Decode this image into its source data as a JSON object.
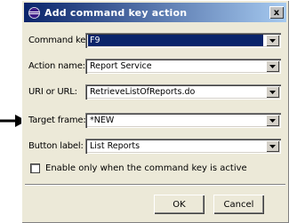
{
  "window": {
    "title": "Add command key action",
    "close_glyph": "x"
  },
  "fields": [
    {
      "label": "Command key:",
      "value": "F9",
      "selected": true
    },
    {
      "label": "Action name:",
      "value": "Report Service",
      "selected": false
    },
    {
      "label": "URI or URL:",
      "value": "RetrieveListOfReports.do",
      "selected": false
    },
    {
      "label": "Target frame:",
      "value": "*NEW",
      "selected": false
    },
    {
      "label": "Button label:",
      "value": "List Reports",
      "selected": false
    }
  ],
  "checkbox": {
    "label": "Enable only when the command key is active",
    "checked": false
  },
  "buttons": {
    "ok_label": "OK",
    "cancel_label": "Cancel"
  },
  "colors": {
    "title_gradient_start": "#0a246a",
    "title_gradient_end": "#a6caf0",
    "selection": "#0a246a",
    "dialog_bg": "#ece9d8"
  },
  "icons": {
    "app": "eclipse-icon",
    "dropdown": "chevron-down-icon",
    "pointer": "arrow-right-icon"
  }
}
